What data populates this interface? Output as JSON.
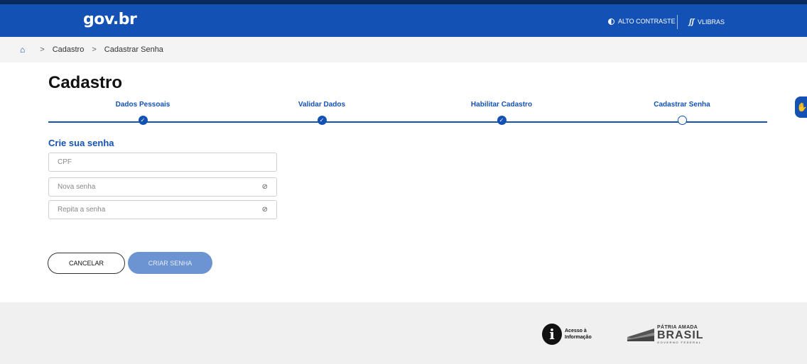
{
  "header": {
    "logo": "gov.br",
    "high_contrast_label": "ALTO CONTRASTE",
    "vlibras_label": "VLIBRAS",
    "accent": "#1351b4"
  },
  "breadcrumb": {
    "home_icon": "home-icon",
    "items": [
      "Cadastro",
      "Cadastrar Senha"
    ]
  },
  "page": {
    "title": "Cadastro"
  },
  "stepper": {
    "steps": [
      {
        "label": "Dados Pessoais",
        "state": "done"
      },
      {
        "label": "Validar Dados",
        "state": "done"
      },
      {
        "label": "Habilitar Cadastro",
        "state": "done"
      },
      {
        "label": "Cadastrar Senha",
        "state": "current"
      }
    ]
  },
  "form": {
    "section_title": "Crie sua senha",
    "cpf_placeholder": "CPF",
    "new_password_placeholder": "Nova senha",
    "repeat_password_placeholder": "Repita a senha"
  },
  "buttons": {
    "cancel": "CANCELAR",
    "create": "CRIAR SENHA"
  },
  "footer": {
    "access_info_line1": "Acesso à",
    "access_info_line2": "Informação",
    "brand_top": "PÁTRIA AMADA",
    "brand_main": "BRASIL",
    "brand_sub": "GOVERNO FEDERAL"
  }
}
